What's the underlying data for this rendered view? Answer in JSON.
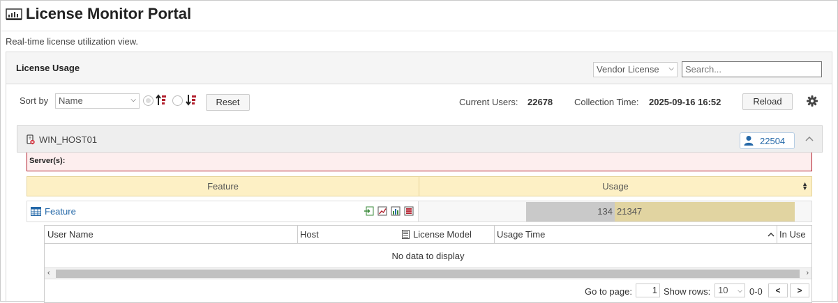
{
  "app": {
    "title": "License Monitor Portal",
    "subtitle": "Real-time license utilization view."
  },
  "panel": {
    "title": "License Usage",
    "vendor_select": {
      "selected": "Vendor License",
      "icon": "chevron-down-icon"
    },
    "search": {
      "placeholder": "Search..."
    }
  },
  "toolbar": {
    "sort_label": "Sort by",
    "sort_select": {
      "selected": "Name"
    },
    "sort_ascending_icon": "sort-ascending-icon",
    "sort_descending_icon": "sort-descending-icon",
    "reset_label": "Reset",
    "current_users_label": "Current Users:",
    "current_users_value": "22678",
    "collection_time_label": "Collection Time:",
    "collection_time_value": "2025-09-16 16:52",
    "reload_label": "Reload",
    "settings_icon": "gear-icon"
  },
  "host": {
    "name": "WIN_HOST01",
    "status_icon": "server-error-icon",
    "user_count": "22504",
    "server_label": "Server(s):"
  },
  "grid": {
    "columns": [
      "Feature",
      "Usage"
    ],
    "rows": [
      {
        "feature": "Feature",
        "used": "134",
        "total": "21347",
        "used_fraction": 0.33
      }
    ]
  },
  "detail": {
    "columns": [
      "User Name",
      "Host",
      "License Model",
      "Usage Time",
      "In Use"
    ],
    "empty_text": "No data to display",
    "pager": {
      "go_to_label": "Go to page:",
      "page_value": "1",
      "show_rows_label": "Show rows:",
      "rows_value": "10",
      "range": "0-0",
      "prev": "<",
      "next": ">"
    }
  },
  "colors": {
    "link": "#2468a8",
    "usage_used": "#c9c9c9",
    "usage_total": "#e1d4a1",
    "header_bg": "#fdf0c5",
    "error_border": "#b21f2d"
  }
}
